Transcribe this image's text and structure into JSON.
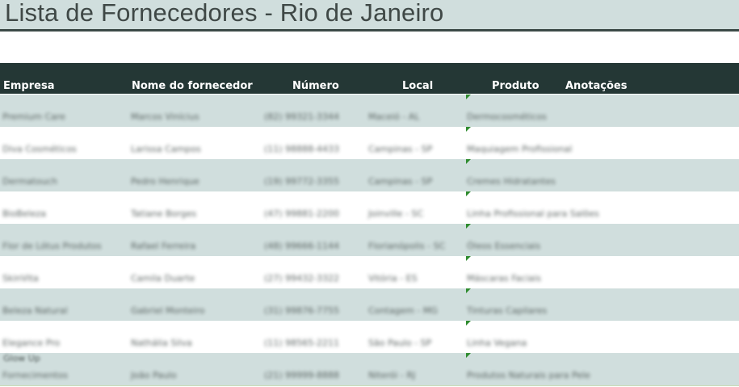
{
  "title": "Lista de Fornecedores - Rio de Janeiro",
  "columns": [
    "Empresa",
    "Nome do fornecedor",
    "Número",
    "Local",
    "Produto",
    "Anotações"
  ],
  "rows": [
    {
      "empresa": "Premium Care",
      "fornecedor": "Marcos Vinícius",
      "numero": "(82) 99321-3344",
      "local": "Maceió - AL",
      "produto": "Dermocosméticos"
    },
    {
      "empresa": "Diva Cosméticos",
      "fornecedor": "Larissa Campos",
      "numero": "(11) 98888-4433",
      "local": "Campinas - SP",
      "produto": "Maquiagem Profissional"
    },
    {
      "empresa": "Dermatouch",
      "fornecedor": "Pedro Henrique",
      "numero": "(19) 99772-3355",
      "local": "Campinas - SP",
      "produto": "Cremes Hidratantes"
    },
    {
      "empresa": "BioBeleza",
      "fornecedor": "Tatiane Borges",
      "numero": "(47) 99881-2200",
      "local": "Joinville - SC",
      "produto": "Linha Profissional para Salões"
    },
    {
      "empresa": "Flor de Lótus Produtos",
      "fornecedor": "Rafael Ferreira",
      "numero": "(48) 99666-1144",
      "local": "Florianópolis - SC",
      "produto": "Óleos Essenciais"
    },
    {
      "empresa": "SkinVita",
      "fornecedor": "Camila Duarte",
      "numero": "(27) 99432-3322",
      "local": "Vitória - ES",
      "produto": "Máscaras Faciais"
    },
    {
      "empresa": "Beleza Natural",
      "fornecedor": "Gabriel Monteiro",
      "numero": "(31) 99876-7755",
      "local": "Contagem - MG",
      "produto": "Tinturas Capilares"
    },
    {
      "empresa": "Elegance Pro",
      "fornecedor": "Nathália Silva",
      "numero": "(11) 98565-2211",
      "local": "São Paulo - SP",
      "produto": "Linha Vegana"
    },
    {
      "empresa": "Fornecimentos",
      "fornecedor": "João Paulo",
      "numero": "(21) 99999-8888",
      "local": "Niterói - RJ",
      "produto": "Produtos Naturais para Pele"
    }
  ],
  "overflow_text": "Glow Up"
}
